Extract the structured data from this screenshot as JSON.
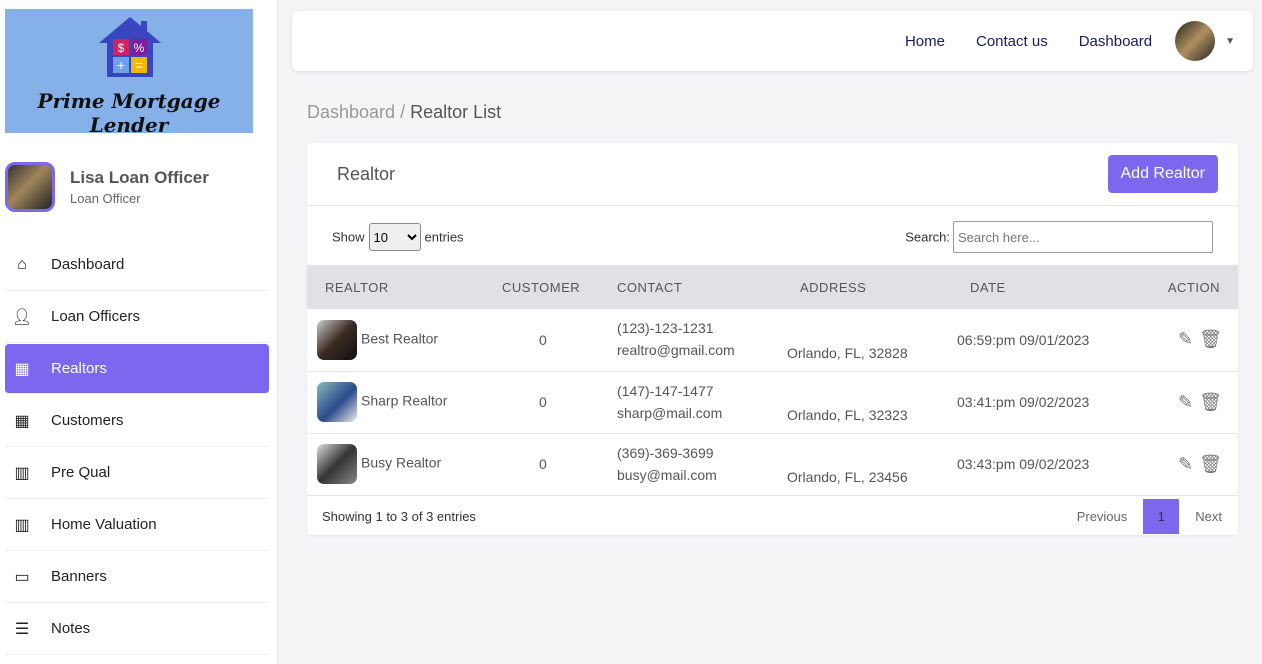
{
  "brand": {
    "name": "Prime Mortgage Lender",
    "symbols": [
      "$",
      "%",
      "+",
      "="
    ]
  },
  "profile": {
    "name": "Lisa Loan Officer",
    "role": "Loan Officer"
  },
  "nav": [
    {
      "label": "Dashboard",
      "icon": "home-icon"
    },
    {
      "label": "Loan Officers",
      "icon": "user-icon"
    },
    {
      "label": "Realtors",
      "icon": "store-icon",
      "active": true
    },
    {
      "label": "Customers",
      "icon": "store-icon"
    },
    {
      "label": "Pre Qual",
      "icon": "bar-chart-icon"
    },
    {
      "label": "Home Valuation",
      "icon": "bar-chart-icon"
    },
    {
      "label": "Banners",
      "icon": "window-icon"
    },
    {
      "label": "Notes",
      "icon": "list-icon"
    }
  ],
  "topnav": {
    "home": "Home",
    "contact": "Contact us",
    "dashboard": "Dashboard"
  },
  "breadcrumb": {
    "parent": "Dashboard",
    "sep": " / ",
    "current": "Realtor List"
  },
  "card": {
    "title": "Realtor",
    "add_label": "Add Realtor"
  },
  "controls": {
    "show": "Show",
    "entries_value": "10",
    "entries": "entries",
    "search_label": "Search:",
    "search_placeholder": "Search here..."
  },
  "columns": [
    "REALTOR",
    "CUSTOMER",
    "CONTACT",
    "ADDRESS",
    "DATE",
    "ACTION"
  ],
  "rows": [
    {
      "name": "Best Realtor",
      "customer": "0",
      "phone": "(123)-123-1231",
      "email": "realtro@gmail.com",
      "address": "Orlando, FL, 32828",
      "date": "06:59:pm 09/01/2023"
    },
    {
      "name": "Sharp Realtor",
      "customer": "0",
      "phone": "(147)-147-1477",
      "email": "sharp@mail.com",
      "address": "Orlando, FL, 32323",
      "date": "03:41:pm 09/02/2023"
    },
    {
      "name": "Busy Realtor",
      "customer": "0",
      "phone": "(369)-369-3699",
      "email": "busy@mail.com",
      "address": "Orlando, FL, 23456",
      "date": "03:43:pm 09/02/2023"
    }
  ],
  "footer": {
    "info": "Showing 1 to 3 of 3 entries",
    "previous": "Previous",
    "page": "1",
    "next": "Next"
  },
  "colors": {
    "accent": "#7b68ee",
    "logo_bg": "#86b0e8"
  }
}
